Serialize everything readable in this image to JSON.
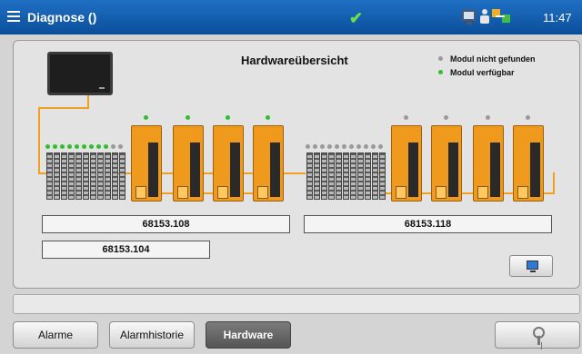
{
  "titlebar": {
    "title": "Diagnose ()",
    "clock": "11:47",
    "icons": [
      "menu-icon",
      "check-icon",
      "monitor-icon",
      "user-icon",
      "network-icon"
    ],
    "status_color": "#6be04a"
  },
  "panel": {
    "heading": "Hardwareübersicht",
    "legend": [
      {
        "label": "Modul nicht gefunden",
        "color": "#9a9a9a"
      },
      {
        "label": "Modul verfügbar",
        "color": "#2fbf2f"
      }
    ],
    "station_a_label": "68153.108",
    "station_b_label": "68153.118",
    "io_label": "68153.104"
  },
  "io_groups": [
    {
      "status_dots": [
        "available",
        "available",
        "available",
        "available",
        "available",
        "available",
        "available",
        "available",
        "available",
        "not_found",
        "not_found"
      ]
    },
    {
      "status_dots": [
        "not_found",
        "not_found",
        "not_found",
        "not_found",
        "not_found",
        "not_found",
        "not_found",
        "not_found",
        "not_found",
        "not_found",
        "not_found"
      ]
    }
  ],
  "drives": [
    {
      "status": "available"
    },
    {
      "status": "available"
    },
    {
      "status": "available"
    },
    {
      "status": "available"
    },
    {
      "status": "not_found"
    },
    {
      "status": "not_found"
    },
    {
      "status": "not_found"
    },
    {
      "status": "not_found"
    }
  ],
  "colors": {
    "available": "#2fbf2f",
    "not_found": "#9a9a9a",
    "bus": "#f0a020",
    "titlebar": "#1f6fc4"
  },
  "footer": {
    "tabs": [
      {
        "label": "Alarme",
        "active": false
      },
      {
        "label": "Alarmhistorie",
        "active": false
      },
      {
        "label": "Hardware",
        "active": true
      }
    ],
    "right_button_icon": "key-icon"
  }
}
